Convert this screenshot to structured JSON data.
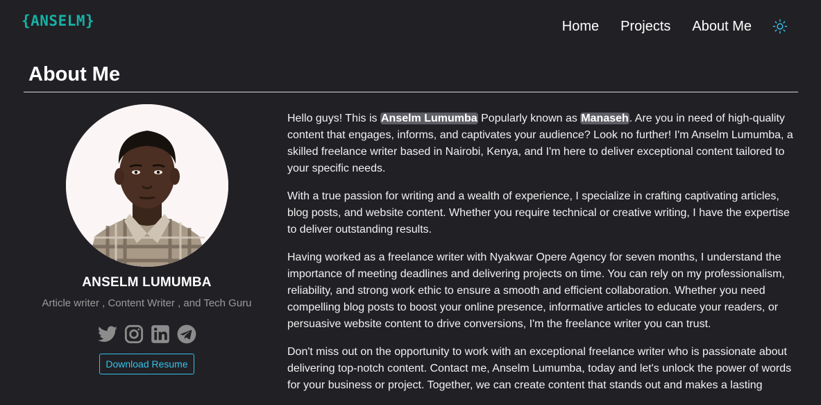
{
  "nav": {
    "brand": "{ANSELM}",
    "links": [
      "Home",
      "Projects",
      "About Me"
    ],
    "theme_icon": "sun-icon"
  },
  "page": {
    "title": "About Me"
  },
  "profile": {
    "name": "ANSELM LUMUMBA",
    "role": "Article writer , Content Writer , and Tech Guru",
    "socials": [
      "twitter-icon",
      "instagram-icon",
      "linkedin-icon",
      "telegram-icon"
    ],
    "resume_button": "Download Resume"
  },
  "bio": {
    "p1": {
      "a": "Hello guys! This is ",
      "name": "Anselm Lumumba",
      "b": " Popularly known as ",
      "nick": "Manaseh",
      "c": ". Are you in need of high-quality content that engages, informs, and captivates your audience? Look no further! I'm Anselm Lumumba, a skilled freelance writer based in Nairobi, Kenya, and I'm here to deliver exceptional content tailored to your specific needs."
    },
    "p2": "With a true passion for writing and a wealth of experience, I specialize in crafting captivating articles, blog posts, and website content. Whether you require technical or creative writing, I have the expertise to deliver outstanding results.",
    "p3": "Having worked as a freelance writer with Nyakwar Opere Agency for seven months, I understand the importance of meeting deadlines and delivering projects on time. You can rely on my professionalism, reliability, and strong work ethic to ensure a smooth and efficient collaboration. Whether you need compelling blog posts to boost your online presence, informative articles to educate your readers, or persuasive website content to drive conversions, I'm the freelance writer you can trust.",
    "p4": "Don't miss out on the opportunity to work with an exceptional freelance writer who is passionate about delivering top-notch content. Contact me, Anselm Lumumba, today and let's unlock the power of words for your business or project. Together, we can create content that stands out and makes a lasting"
  },
  "colors": {
    "background": "#212025",
    "brand": "#17b1a4",
    "accent": "#34c2ea",
    "highlight": "#5e5e66",
    "muted": "#9b9b9b"
  }
}
